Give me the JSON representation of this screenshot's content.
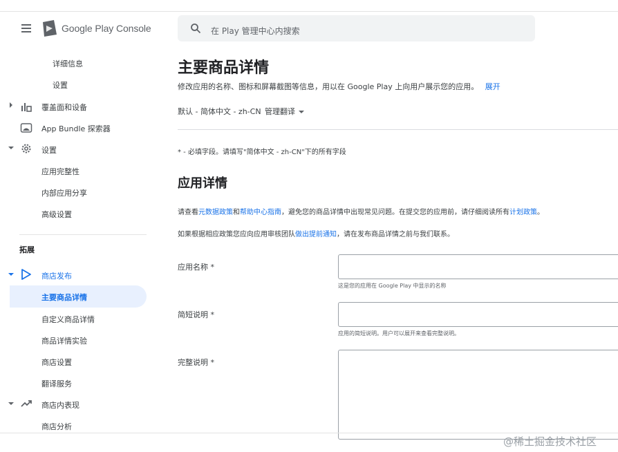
{
  "header": {
    "brand": "Google Play Console",
    "search_placeholder": "在 Play 管理中心内搜索"
  },
  "sidebar": {
    "items_top": [
      {
        "label": "详细信息"
      },
      {
        "label": "设置"
      }
    ],
    "sections": [
      {
        "label": "覆盖面和设备"
      },
      {
        "label": "App Bundle 探索器"
      },
      {
        "label": "设置"
      }
    ],
    "settings_children": [
      {
        "label": "应用完整性"
      },
      {
        "label": "内部应用分享"
      },
      {
        "label": "高级设置"
      }
    ],
    "group_title": "拓展",
    "store_presence": {
      "label": "商店发布",
      "children": [
        {
          "label": "主要商品详情"
        },
        {
          "label": "自定义商品详情"
        },
        {
          "label": "商品详情实验"
        },
        {
          "label": "商店设置"
        },
        {
          "label": "翻译服务"
        }
      ]
    },
    "store_performance": {
      "label": "商店内表现",
      "children": [
        {
          "label": "商店分析"
        }
      ]
    }
  },
  "main": {
    "title": "主要商品详情",
    "subtitle": "修改应用的名称、图标和屏幕截图等信息，用以在 Google Play 上向用户展示您的应用。",
    "expand_link": "展开",
    "language": "默认 - 简体中文 - zh-CN",
    "manage_translations": "管理翻译",
    "required_note": "* - 必填字段。请填写\"简体中文 - zh-CN\"下的所有字段",
    "section_title": "应用详情",
    "para1": {
      "t1": "请查看",
      "link1": "元数据政策",
      "t2": "和",
      "link2": "帮助中心指南",
      "t3": "，避免您的商品详情中出现常见问题。在提交您的应用前，请仔细阅读所有",
      "link3": "计划政策",
      "t4": "。"
    },
    "para2": {
      "t1": "如果根据相应政策您应向应用审核团队",
      "link1": "做出提前通知",
      "t2": "，请在发布商品详情之前与我们联系。"
    },
    "fields": [
      {
        "label": "应用名称 *",
        "value": "",
        "hint": "这是您的应用在 Google Play 中显示的名称"
      },
      {
        "label": "简短说明 *",
        "value": "",
        "hint": "应用的简短说明。用户可以展开来查看完整说明。"
      },
      {
        "label": "完整说明 *",
        "value": ""
      }
    ]
  },
  "watermark": "@稀土掘金技术社区",
  "colors": {
    "accent": "#1a73e8",
    "active_bg": "#e8f0fe",
    "search_bg": "#f1f3f4"
  }
}
